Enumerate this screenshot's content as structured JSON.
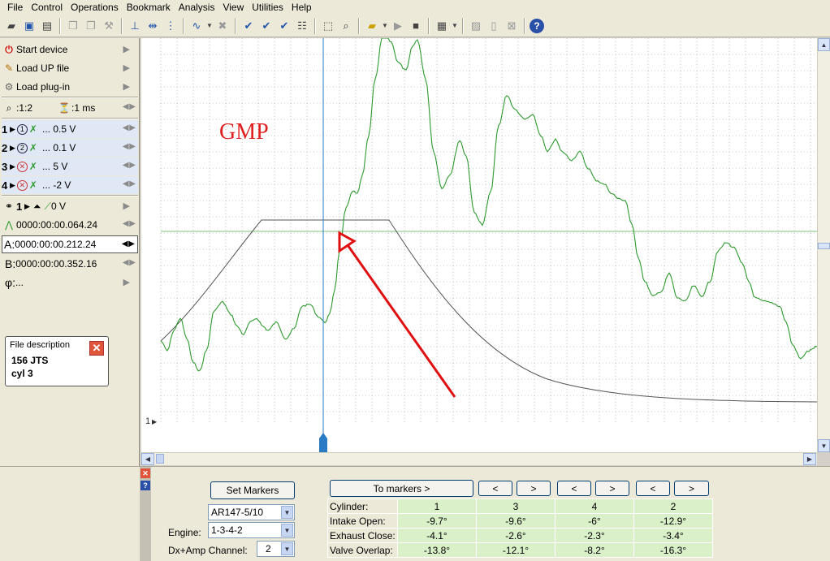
{
  "menu": [
    "File",
    "Control",
    "Operations",
    "Bookmark",
    "Analysis",
    "View",
    "Utilities",
    "Help"
  ],
  "toolbar": {
    "icons": [
      "open-icon",
      "save-icon",
      "print-icon",
      "copy-icon",
      "paste-icon",
      "tool-icon",
      "cursor-icon",
      "measure-icon",
      "filter-icon",
      "waveform-icon",
      "delete-icon",
      "check-icon",
      "check-double-icon",
      "check-triple-icon",
      "list-icon",
      "zoom-fit-icon",
      "zoom-icon",
      "folder-icon",
      "play-icon",
      "stop-icon",
      "table-icon",
      "chart-icon",
      "page-icon",
      "close-doc-icon",
      "help-icon"
    ],
    "help_label": "?"
  },
  "left": {
    "start_device": "Start device",
    "load_up_file": "Load UP file",
    "load_plugin": "Load plug-in",
    "zoom": ":1:2",
    "timebase": ":1 ms",
    "channels": [
      {
        "num": "1",
        "circle": "1",
        "value": "... 0.5 V"
      },
      {
        "num": "2",
        "circle": "2",
        "value": "... 0.1 V"
      },
      {
        "num": "3",
        "circle": "",
        "value": "... 5 V"
      },
      {
        "num": "4",
        "circle": "",
        "value": "... -2 V"
      }
    ],
    "trigger_channel": "1",
    "trigger_value": "0 V",
    "delta_time": "0000:00:00.064.24",
    "marker_a": "0000:00:00.212.24",
    "marker_b": "0000:00:00.352.16",
    "phi": "...",
    "label_a": "A:",
    "label_b": "B:",
    "label_phi": "φ:"
  },
  "file_description": {
    "title": "File description",
    "line1": "156 JTS",
    "line2": "cyl 3"
  },
  "plot": {
    "annotation": "GMP",
    "channel_marker": "1"
  },
  "bottom": {
    "set_markers": "Set Markers",
    "to_markers": "To markers >",
    "nav": [
      "<",
      ">",
      "<",
      ">",
      "<",
      ">"
    ],
    "model": "AR147-5/10",
    "engine_label": "Engine:",
    "engine_value": "1-3-4-2",
    "channel_label": "Dx+Amp Channel:",
    "channel_value": "2",
    "table": [
      {
        "label": "Cylinder:",
        "values": [
          "1",
          "3",
          "4",
          "2"
        ]
      },
      {
        "label": "Intake Open:",
        "values": [
          "-9.7°",
          "-9.6°",
          "-6°",
          "-12.9°"
        ]
      },
      {
        "label": "Exhaust Close:",
        "values": [
          "-4.1°",
          "-2.6°",
          "-2.3°",
          "-3.4°"
        ]
      },
      {
        "label": "Valve Overlap:",
        "values": [
          "-13.8°",
          "-12.1°",
          "-8.2°",
          "-16.3°"
        ]
      }
    ]
  },
  "colors": {
    "signal": "#2e9a2e",
    "envelope": "#555555",
    "cursor": "#2a7bc4",
    "arrow": "#e01010",
    "annotation": "#e02020"
  }
}
